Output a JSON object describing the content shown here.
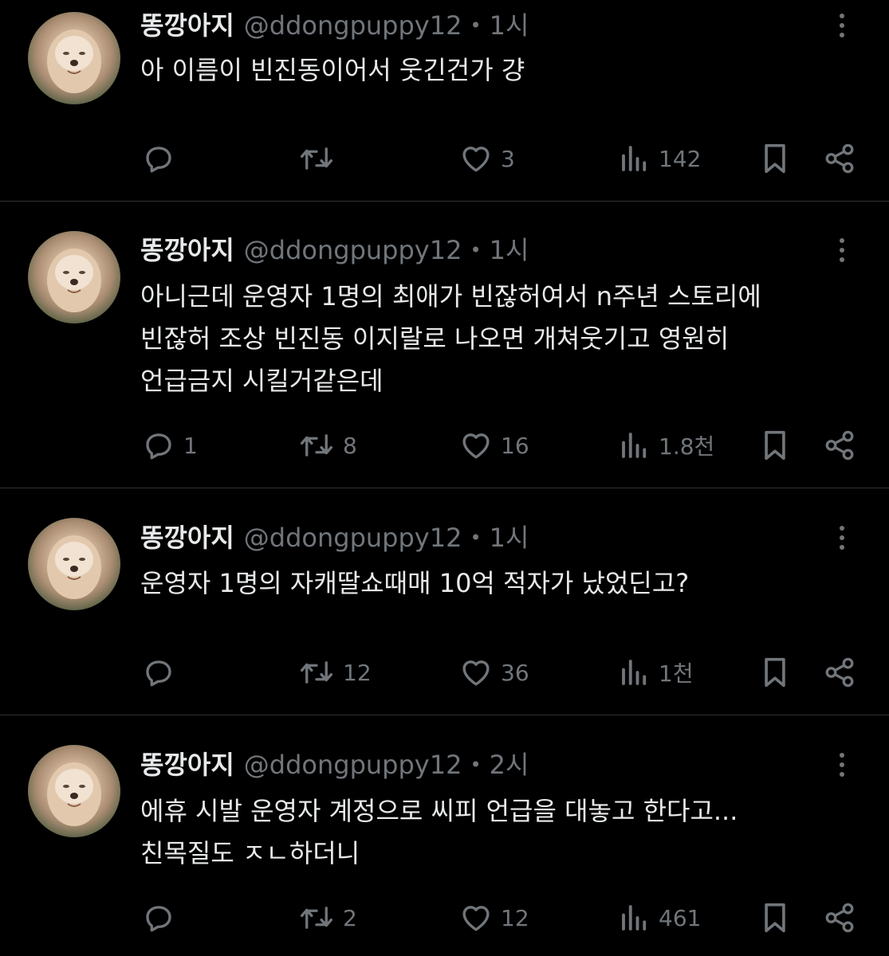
{
  "tweets": [
    {
      "name": "똥깡아지",
      "handle": "@ddongpuppy12",
      "separator": "•",
      "time": "1시",
      "lines": [
        "아 이름이 빈진동이어서 웃긴건가 걍"
      ],
      "replies": "",
      "retweets": "",
      "likes": "3",
      "views": "142"
    },
    {
      "name": "똥깡아지",
      "handle": "@ddongpuppy12",
      "separator": "•",
      "time": "1시",
      "lines": [
        "아니근데 운영자 1명의 최애가 빈잖허여서 n주년 스토리에",
        "빈잖허 조상 빈진동 이지랄로 나오면 개쳐웃기고 영원히",
        "언급금지 시킬거같은데"
      ],
      "replies": "1",
      "retweets": "8",
      "likes": "16",
      "views": "1.8천"
    },
    {
      "name": "똥깡아지",
      "handle": "@ddongpuppy12",
      "separator": "•",
      "time": "1시",
      "lines": [
        "운영자 1명의 자캐딸쇼때매 10억 적자가 났었딘고?"
      ],
      "replies": "",
      "retweets": "12",
      "likes": "36",
      "views": "1천"
    },
    {
      "name": "똥깡아지",
      "handle": "@ddongpuppy12",
      "separator": "•",
      "time": "2시",
      "lines": [
        "에휴 시발 운영자 계정으로 씨피 언급을 대놓고 한다고...",
        "친목질도 ㅈㄴ하더니"
      ],
      "replies": "",
      "retweets": "2",
      "likes": "12",
      "views": "461"
    }
  ],
  "icons": {
    "reply": "reply-icon",
    "retweet": "retweet-icon",
    "like": "heart-icon",
    "views": "views-icon",
    "bookmark": "bookmark-icon",
    "share": "share-icon",
    "more": "more-icon"
  },
  "colors": {
    "background": "#000000",
    "text": "#e7e9ea",
    "muted": "#71767b",
    "divider": "#2f3336"
  }
}
